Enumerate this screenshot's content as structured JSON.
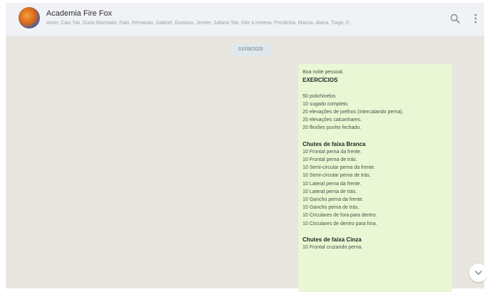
{
  "header": {
    "title": "Academia Fire Fox",
    "members": "Amor, Caio Tati, Duda Machado, Fabi, Fernando, Gabriel, Gustavo, Jenifer, Jullana Tati, Olle à Helena, Pricillinha, Marcio, Alana, Tiago, F..."
  },
  "chat": {
    "date": "01/09/2020",
    "message": {
      "lines": [
        {
          "text": "Boa noite pessoal.",
          "bold": false
        },
        {
          "text": "EXERCÍCIOS",
          "bold": true
        },
        {
          "text": "",
          "bold": false
        },
        {
          "text": "50 polichinelos",
          "bold": false
        },
        {
          "text": "10 sugado completo.",
          "bold": false
        },
        {
          "text": "20 elevações de joelhos (intercalando perna).",
          "bold": false
        },
        {
          "text": "20 elevações calcanhares.",
          "bold": false
        },
        {
          "text": "20 flexões punho fechado.",
          "bold": false
        },
        {
          "text": "",
          "bold": false
        },
        {
          "text": "Chutes de faixa Branca",
          "bold": true
        },
        {
          "text": "10 Frontal perna da frente.",
          "bold": false
        },
        {
          "text": "10 Frontal perna de trás.",
          "bold": false
        },
        {
          "text": "10 Semi-circular perna da frente.",
          "bold": false
        },
        {
          "text": "10 Semi-circular perna de trás.",
          "bold": false
        },
        {
          "text": "10 Lateral perna da frente.",
          "bold": false
        },
        {
          "text": "10 Lateral perna de trás.",
          "bold": false
        },
        {
          "text": "10 Gancho perna da frente.",
          "bold": false
        },
        {
          "text": "10 Gancho perna de trás.",
          "bold": false
        },
        {
          "text": "10 Circulares de fora para dentro.",
          "bold": false
        },
        {
          "text": "10 Circulares de dentro para fora.",
          "bold": false
        },
        {
          "text": "",
          "bold": false
        },
        {
          "text": "Chutes de faixa Cinza",
          "bold": true
        },
        {
          "text": "10 Frontal cruzando perna.",
          "bold": false
        }
      ]
    }
  },
  "icons": {
    "search": "search-icon",
    "menu": "more-vertical-icon",
    "scroll": "chevron-down-icon"
  },
  "colors": {
    "header_bg": "#f0f2f5",
    "chat_bg": "#e9e6df",
    "bubble_bg": "#eaf7d4"
  }
}
